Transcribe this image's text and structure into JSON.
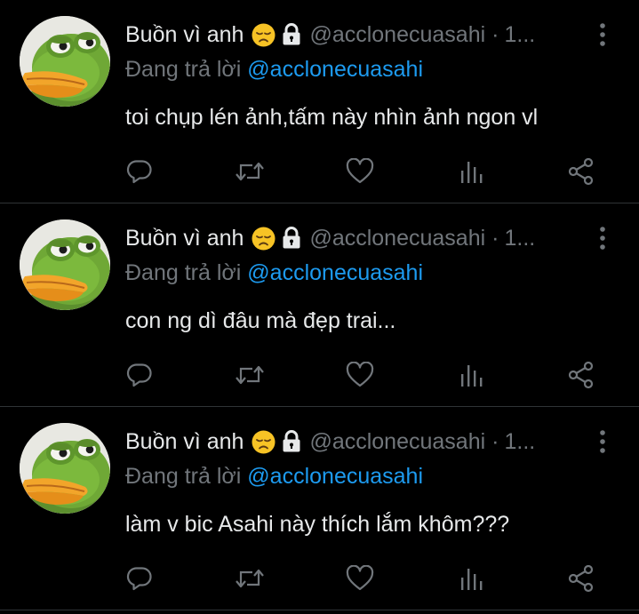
{
  "theme": {
    "background": "#000000",
    "text_primary": "#e7e9ea",
    "text_secondary": "#71767b",
    "accent": "#1d9bf0",
    "divider": "#2f3336"
  },
  "tweets": [
    {
      "display_name": "Buồn vì anh",
      "emoji_icon": "disappointed-face-icon",
      "lock_icon": "lock-icon",
      "handle": "@acclonecuasahi",
      "separator": "·",
      "time": "1...",
      "reply_prefix": "Đang trả lời",
      "reply_mention": "@acclonecuasahi",
      "text": "toi chụp lén ảnh,tấm này nhìn ảnh ngon vl",
      "actions": [
        "reply-icon",
        "retweet-icon",
        "like-icon",
        "analytics-icon",
        "share-icon"
      ]
    },
    {
      "display_name": "Buồn vì anh",
      "emoji_icon": "disappointed-face-icon",
      "lock_icon": "lock-icon",
      "handle": "@acclonecuasahi",
      "separator": "·",
      "time": "1...",
      "reply_prefix": "Đang trả lời",
      "reply_mention": "@acclonecuasahi",
      "text": "con ng dì đâu mà đẹp trai...",
      "actions": [
        "reply-icon",
        "retweet-icon",
        "like-icon",
        "analytics-icon",
        "share-icon"
      ]
    },
    {
      "display_name": "Buồn vì anh",
      "emoji_icon": "disappointed-face-icon",
      "lock_icon": "lock-icon",
      "handle": "@acclonecuasahi",
      "separator": "·",
      "time": "1...",
      "reply_prefix": "Đang trả lời",
      "reply_mention": "@acclonecuasahi",
      "text": "làm v bic Asahi này thích lắm khôm???",
      "actions": [
        "reply-icon",
        "retweet-icon",
        "like-icon",
        "analytics-icon",
        "share-icon"
      ]
    }
  ]
}
